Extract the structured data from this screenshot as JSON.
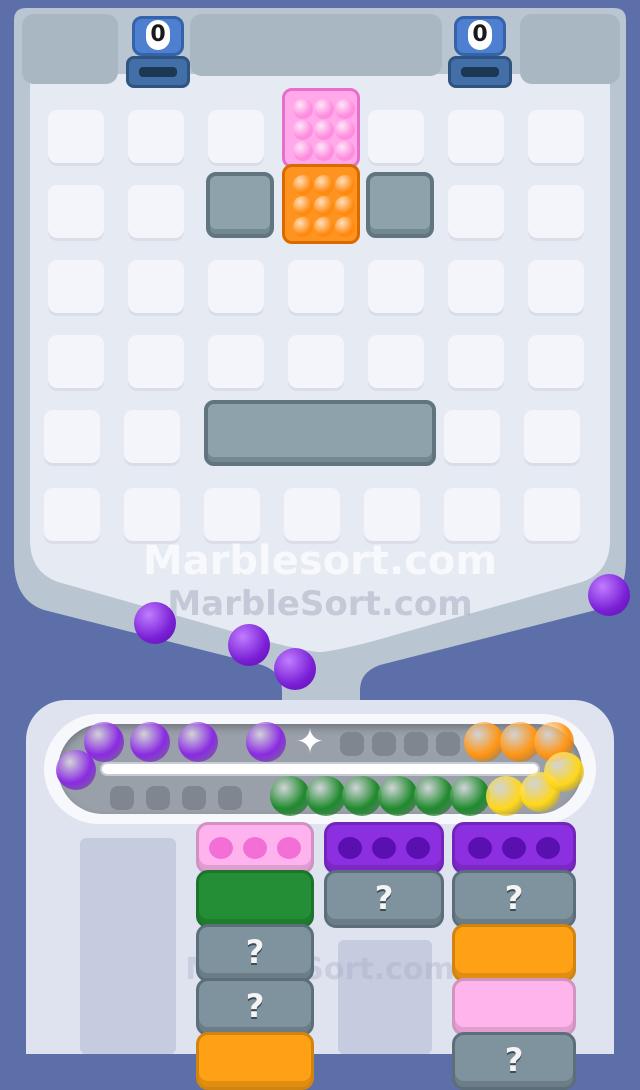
{
  "game": {
    "watermark_main": "Marblesort.com",
    "watermark_faint": "MarbleSort.com",
    "watermark_lower": "MarbleSort.com"
  },
  "counters": [
    {
      "value": "0",
      "color": "#4f7fd0"
    },
    {
      "value": "0",
      "color": "#4f7fd0"
    }
  ],
  "grid": {
    "rows": 6,
    "cols": 7,
    "cell_color": "#f3f5fa"
  },
  "marble_blocks": [
    {
      "color": "#ff8ddf",
      "rows": 3,
      "cols": 3,
      "name": "pink"
    },
    {
      "color": "#ff8a10",
      "rows": 3,
      "cols": 3,
      "name": "orange"
    }
  ],
  "obstacles": [
    "small",
    "small",
    "long"
  ],
  "loose_marbles": {
    "color": "#8a2be2",
    "count": 4
  },
  "belt": {
    "top_row": [
      "#8a2be2",
      "#8a2be2",
      "#8a2be2",
      "#8a2be2",
      "#ff9513",
      "#ff9513",
      "#ff9513"
    ],
    "bottom_row": [
      "#1f8a2c",
      "#1f8a2c",
      "#1f8a2c",
      "#1f8a2c",
      "#1f8a2c",
      "#1f8a2c",
      "#ffd71a",
      "#ffd71a",
      "#ffd71a"
    ],
    "left_end": "#8a2be2",
    "star_icon": "✦"
  },
  "bins": {
    "col1": [
      {
        "type": "open",
        "color": "#ffb3ee",
        "dot_color": "#f46fd5"
      },
      {
        "type": "solid",
        "color": "#238e35"
      },
      {
        "type": "hidden",
        "label": "?"
      },
      {
        "type": "hidden",
        "label": "?"
      },
      {
        "type": "solid",
        "color": "#ffa114"
      }
    ],
    "col2": [
      {
        "type": "open",
        "color": "#8b2fe0",
        "dot_color": "#5a0fb0"
      },
      {
        "type": "hidden",
        "label": "?"
      }
    ],
    "col3": [
      {
        "type": "open",
        "color": "#8b2fe0",
        "dot_color": "#5a0fb0"
      },
      {
        "type": "hidden",
        "label": "?"
      },
      {
        "type": "solid",
        "color": "#ffa114"
      },
      {
        "type": "solid",
        "color": "#ffb5ec"
      },
      {
        "type": "hidden",
        "label": "?"
      }
    ]
  }
}
